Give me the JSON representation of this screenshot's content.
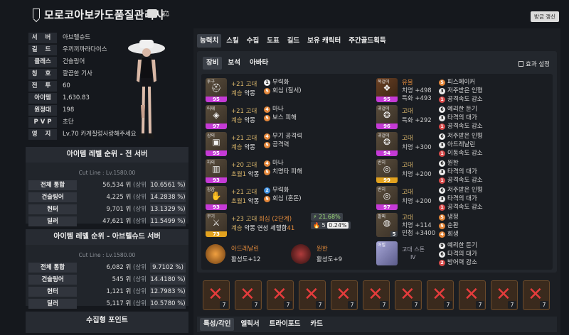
{
  "header": {
    "title": "모로코아보카도품질관리사",
    "refresh_label": "방금 갱신"
  },
  "profile": {
    "rows": [
      {
        "label": "서 버",
        "value": "아브렐슈드"
      },
      {
        "label": "길 드",
        "value": "우끼끼까라다이스"
      },
      {
        "label": "클래스",
        "value": "건슬링어"
      },
      {
        "label": "칭 호",
        "value": "깔끔한 기사"
      },
      {
        "label": "전 투",
        "value": "60"
      },
      {
        "label": "아이템",
        "value": "1,630.83"
      },
      {
        "label": "원정대",
        "value": "198"
      },
      {
        "label": "P V P",
        "value": "초단"
      },
      {
        "label": "영 지",
        "value": "Lv.70 카게질렁사랑해주세요"
      }
    ]
  },
  "rank_all": {
    "title": "아이템 레벨 순위 - 전 서버",
    "cut_line": "Cut Line : Lv.1580.00",
    "rows": [
      {
        "name": "전체 통합",
        "rank": "56,534 위",
        "sub": "(상위",
        "pct": "10.6561 %)"
      },
      {
        "name": "건슬링어",
        "rank": "4,225 위",
        "sub": "(상위",
        "pct": "14.2838 %)"
      },
      {
        "name": "헌터",
        "rank": "9,701 위",
        "sub": "(상위",
        "pct": "13.1329 %)"
      },
      {
        "name": "딜러",
        "rank": "47,621 위",
        "sub": "(상위",
        "pct": "11.5499 %)"
      }
    ]
  },
  "rank_server": {
    "title": "아이템 레벨 순위 - 아브렐슈드 서버",
    "cut_line": "Cut Line : Lv.1580.00",
    "rows": [
      {
        "name": "전체 통합",
        "rank": "6,082 위",
        "sub": "(상위",
        "pct": "9.7102 %)"
      },
      {
        "name": "건슬링어",
        "rank": "545 위",
        "sub": "(상위",
        "pct": "14.4180 %)"
      },
      {
        "name": "헌터",
        "rank": "1,121 위",
        "sub": "(상위",
        "pct": "12.7983 %)"
      },
      {
        "name": "딜러",
        "rank": "5,117 위",
        "sub": "(상위",
        "pct": "10.5780 %)"
      }
    ]
  },
  "collect_title": "수집형 포인트",
  "tabs": [
    "능력치",
    "스킬",
    "수집",
    "도표",
    "길드",
    "보유 캐릭터",
    "주간골드획득"
  ],
  "subtabs": [
    "장비",
    "보석",
    "아바타"
  ],
  "effect_setting": "효과 설정",
  "equipment": [
    {
      "slot": "투구",
      "quality": "95",
      "glyph": "⛑",
      "l1a": "+21 고대",
      "l1b": "",
      "l2a": "계승",
      "l2b": "악몽",
      "effects": [
        {
          "lv": "1",
          "c": "d-white",
          "name": "무력화"
        },
        {
          "lv": "5",
          "c": "d-orange",
          "name": "회심 (질서)"
        }
      ]
    },
    {
      "slot": "어깨",
      "quality": "97",
      "glyph": "◈",
      "l1a": "+21 고대",
      "l1b": "",
      "l2a": "계승",
      "l2b": "악몽",
      "effects": [
        {
          "lv": "4",
          "c": "d-orange",
          "name": "마나"
        },
        {
          "lv": "5",
          "c": "d-orange",
          "name": "보스 피해"
        }
      ]
    },
    {
      "slot": "상의",
      "quality": "95",
      "glyph": "▣",
      "l1a": "+21 고대",
      "l1b": "",
      "l2a": "계승",
      "l2b": "악몽",
      "effects": [
        {
          "lv": "4",
          "c": "d-orange",
          "name": "무기 공격력"
        },
        {
          "lv": "5",
          "c": "d-orange",
          "name": "공격력"
        }
      ]
    },
    {
      "slot": "하의",
      "quality": "93",
      "glyph": "▥",
      "l1a": "+20 고대",
      "l1b": "",
      "l2a": "초월1",
      "l2b": "악몽",
      "effects": [
        {
          "lv": "4",
          "c": "d-orange",
          "name": "마나"
        },
        {
          "lv": "5",
          "c": "d-orange",
          "name": "치명타 피해"
        }
      ]
    },
    {
      "slot": "장갑",
      "quality": "93",
      "glyph": "✋",
      "l1a": "+21 고대",
      "l1b": "",
      "l2a": "초월1",
      "l2b": "악몽",
      "effects": [
        {
          "lv": "2",
          "c": "d-blue",
          "name": "무력화"
        },
        {
          "lv": "5",
          "c": "d-orange",
          "name": "회심 (혼돈)"
        }
      ]
    },
    {
      "slot": "무기",
      "quality": "73",
      "glyph": "⚔",
      "l1a": "+23 고대",
      "l1b": "회심 (2단계)",
      "l2a": "계승",
      "l2b": "악몽",
      "effects": [],
      "weapon_extra": "연성 세렐합",
      "weapon_num": "41",
      "chip1": "21.68%",
      "chip2a": "5",
      "chip2b": "0.24%"
    }
  ],
  "accessories": [
    {
      "slot": "목걸이",
      "quality": "95",
      "l1": "유물",
      "l1class": "c-orange",
      "l2": "치명 +498",
      "l3": "특화 +493",
      "effects": [
        {
          "lv": "5",
          "c": "d-orange",
          "name": "피스메이커"
        },
        {
          "lv": "3",
          "c": "d-white",
          "name": "저주받은 인형"
        },
        {
          "lv": "1",
          "c": "d-red",
          "name": "공격속도 감소"
        }
      ]
    },
    {
      "slot": "귀걸이",
      "quality": "96",
      "l1": "고대",
      "l1class": "c-gold",
      "l2": "특화 +292",
      "l3": "",
      "effects": [
        {
          "lv": "6",
          "c": "d-white",
          "name": "예리한 둔기"
        },
        {
          "lv": "3",
          "c": "d-white",
          "name": "타격의 대가"
        },
        {
          "lv": "1",
          "c": "d-red",
          "name": "공격속도 감소"
        }
      ]
    },
    {
      "slot": "귀걸이",
      "quality": "94",
      "l1": "고대",
      "l1class": "c-gold",
      "l2": "치명 +300",
      "l3": "",
      "effects": [
        {
          "lv": "6",
          "c": "d-white",
          "name": "저주받은 인형"
        },
        {
          "lv": "3",
          "c": "d-white",
          "name": "아드레날린"
        },
        {
          "lv": "1",
          "c": "d-red",
          "name": "이동속도 감소"
        }
      ]
    },
    {
      "slot": "반지",
      "quality": "99",
      "l1": "고대",
      "l1class": "c-gold",
      "l2": "치명 +200",
      "l3": "",
      "effects": [
        {
          "lv": "6",
          "c": "d-white",
          "name": "원한"
        },
        {
          "lv": "3",
          "c": "d-white",
          "name": "타격의 대가"
        },
        {
          "lv": "1",
          "c": "d-red",
          "name": "공격속도 감소"
        }
      ]
    },
    {
      "slot": "반지",
      "quality": "97",
      "l1": "고대",
      "l1class": "c-gold",
      "l2": "치명 +200",
      "l3": "",
      "effects": [
        {
          "lv": "6",
          "c": "d-white",
          "name": "저주받은 인형"
        },
        {
          "lv": "3",
          "c": "d-white",
          "name": "타격의 대가"
        },
        {
          "lv": "1",
          "c": "d-red",
          "name": "공격속도 감소"
        }
      ]
    },
    {
      "slot": "팔찌",
      "quality": "",
      "l1": "고대",
      "l1class": "c-gold",
      "l2": "치명 +114",
      "l3": "민첩 +3400",
      "effects": [
        {
          "lv": "5",
          "c": "d-orange",
          "name": "냉정"
        },
        {
          "lv": "5",
          "c": "d-orange",
          "name": "순환"
        },
        {
          "lv": "4",
          "c": "d-orange",
          "name": "회생"
        }
      ]
    }
  ],
  "bracelet_tag": "5",
  "extras": {
    "e1_name": "아드레날린",
    "e1_sub": "활성도+12",
    "e2_name": "원한",
    "e2_sub": "활성도+9",
    "stone_label": "어빌",
    "stone_name": "고대 스톤",
    "stone_tier": "Ⅳ",
    "stone_effects": [
      {
        "lv": "9",
        "c": "d-white",
        "name": "예리한 둔기"
      },
      {
        "lv": "6",
        "c": "d-white",
        "name": "타격의 대가"
      },
      {
        "lv": "2",
        "c": "d-red",
        "name": "방어력 감소"
      }
    ]
  },
  "gems": [
    "7",
    "7",
    "7",
    "7",
    "7",
    "7",
    "7",
    "7",
    "7",
    "7",
    "7"
  ],
  "bottom_tabs": [
    "특성/각인",
    "엘릭서",
    "트라이포드",
    "카드"
  ]
}
